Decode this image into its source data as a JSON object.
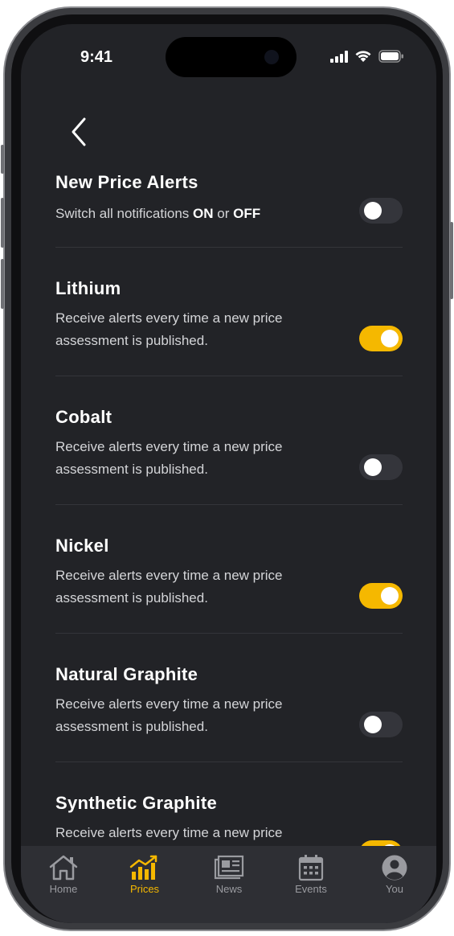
{
  "status_bar": {
    "time": "9:41"
  },
  "header": {
    "back_icon": "chevron-left-icon"
  },
  "master": {
    "title": "New Price Alerts",
    "desc_prefix": "Switch all notifications ",
    "desc_on": "ON",
    "desc_mid": " or ",
    "desc_off": "OFF",
    "enabled": false
  },
  "items": [
    {
      "title": "Lithium",
      "desc": "Receive alerts every time a new price assessment is published.",
      "enabled": true
    },
    {
      "title": "Cobalt",
      "desc": "Receive alerts every time a new price assessment is published.",
      "enabled": false
    },
    {
      "title": "Nickel",
      "desc": "Receive alerts every time a new price assessment is published.",
      "enabled": true
    },
    {
      "title": "Natural Graphite",
      "desc": "Receive alerts every time a new price assessment is published.",
      "enabled": false
    },
    {
      "title": "Synthetic Graphite",
      "desc": "Receive alerts every time a new price",
      "enabled": true
    }
  ],
  "tabbar": {
    "tabs": [
      {
        "label": "Home",
        "icon": "home-icon",
        "active": false
      },
      {
        "label": "Prices",
        "icon": "chart-icon",
        "active": true
      },
      {
        "label": "News",
        "icon": "news-icon",
        "active": false
      },
      {
        "label": "Events",
        "icon": "calendar-icon",
        "active": false
      },
      {
        "label": "You",
        "icon": "profile-icon",
        "active": false
      }
    ]
  },
  "colors": {
    "background": "#222327",
    "accent": "#f5b800",
    "toggle_off": "#34353b",
    "tabbar": "#2e2f34",
    "divider": "#34353a"
  }
}
